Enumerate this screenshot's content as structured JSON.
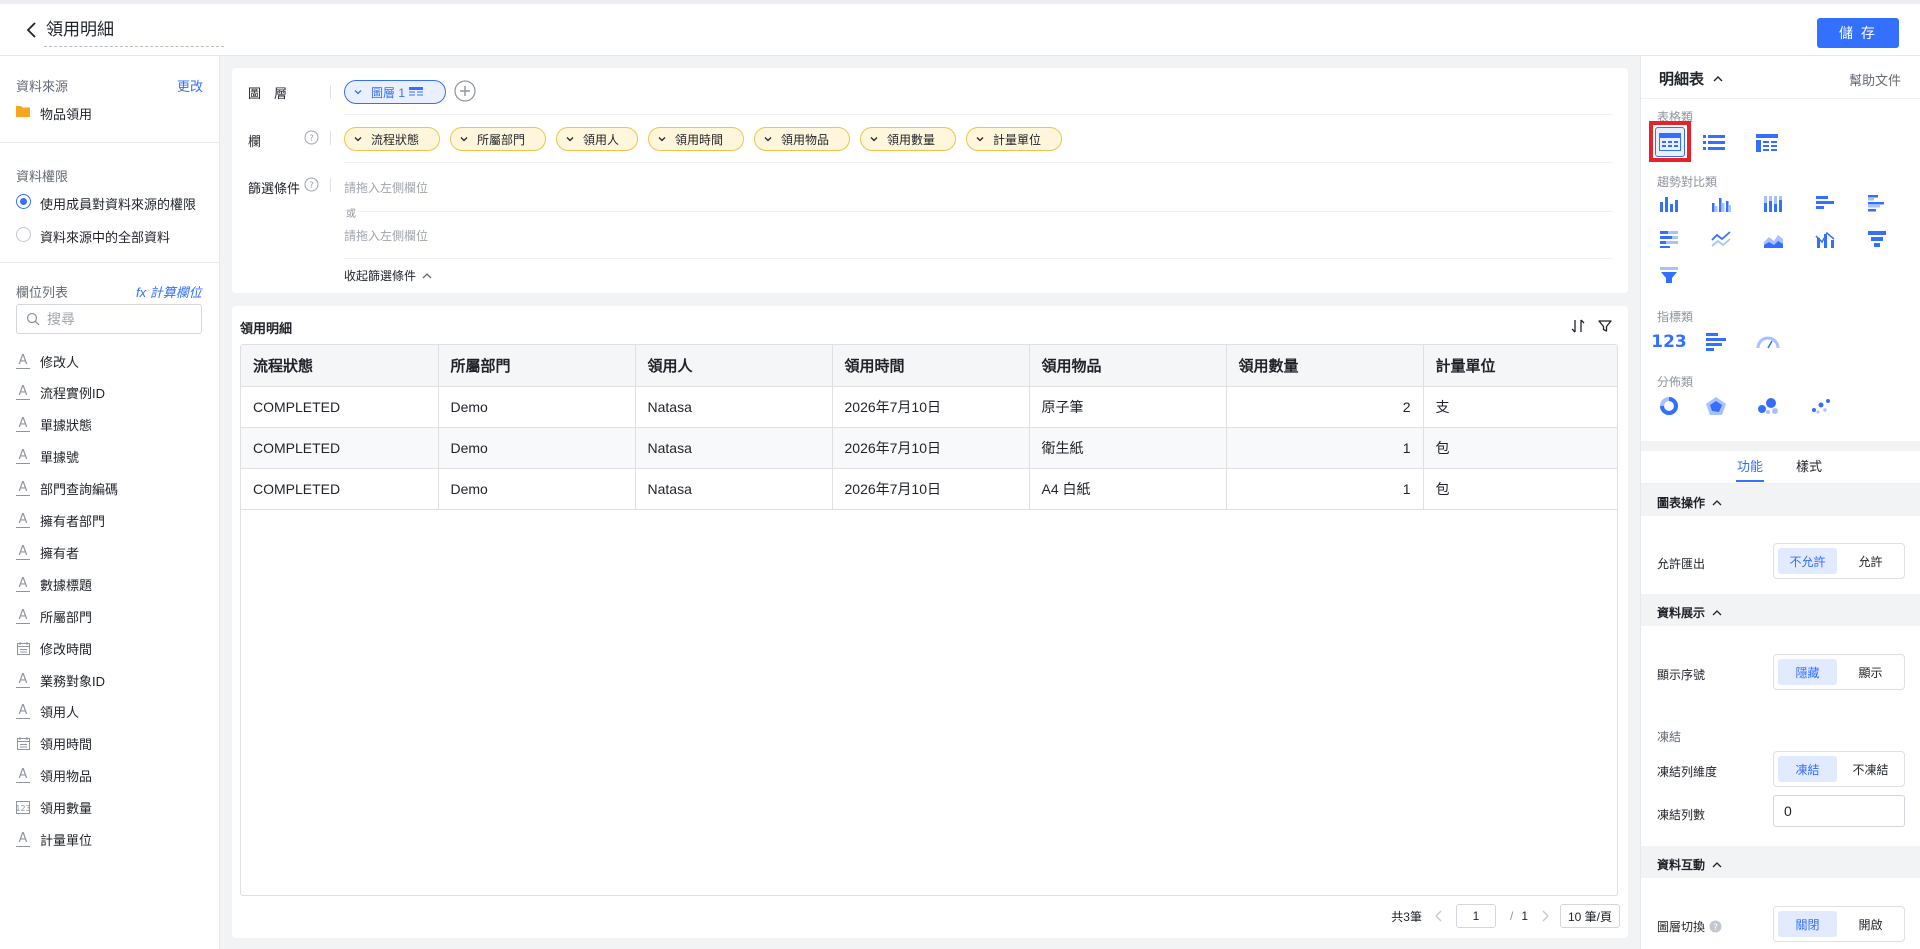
{
  "header": {
    "title": "領用明細",
    "save_label": "儲 存"
  },
  "left": {
    "datasource_label": "資料來源",
    "datasource_change": "更改",
    "datasource_name": "物品領用",
    "permission_label": "資料權限",
    "permission_options": [
      "使用成員對資料來源的權限",
      "資料來源中的全部資料"
    ],
    "permission_selected": 0,
    "fields_label": "欄位列表",
    "calc_field": "fx 計算欄位",
    "search_placeholder": "搜尋",
    "fields": [
      {
        "icon": "text",
        "label": "修改人"
      },
      {
        "icon": "text",
        "label": "流程實例ID"
      },
      {
        "icon": "text",
        "label": "單據狀態"
      },
      {
        "icon": "text",
        "label": "單據號"
      },
      {
        "icon": "text",
        "label": "部門查詢編碼"
      },
      {
        "icon": "text",
        "label": "擁有者部門"
      },
      {
        "icon": "text",
        "label": "擁有者"
      },
      {
        "icon": "text",
        "label": "數據標題"
      },
      {
        "icon": "text",
        "label": "所屬部門"
      },
      {
        "icon": "date",
        "label": "修改時間"
      },
      {
        "icon": "text",
        "label": "業務對象ID"
      },
      {
        "icon": "text",
        "label": "領用人"
      },
      {
        "icon": "date",
        "label": "領用時間"
      },
      {
        "icon": "text",
        "label": "領用物品"
      },
      {
        "icon": "number",
        "label": "領用數量"
      },
      {
        "icon": "text",
        "label": "計量單位"
      }
    ]
  },
  "config": {
    "layer_label": "圖　層",
    "layer_pill": "圖層 1",
    "column_label": "欄",
    "columns": [
      "流程狀態",
      "所屬部門",
      "領用人",
      "領用時間",
      "領用物品",
      "領用數量",
      "計量單位"
    ],
    "filter_label": "篩選條件",
    "filter_placeholder_1": "請拖入左側欄位",
    "filter_or": "或",
    "filter_placeholder_2": "請拖入左側欄位",
    "collapse_label": "收起篩選條件"
  },
  "table": {
    "title": "領用明細",
    "headers": [
      "流程狀態",
      "所屬部門",
      "領用人",
      "領用時間",
      "領用物品",
      "領用數量",
      "計量單位"
    ],
    "rows": [
      [
        "COMPLETED",
        "Demo",
        "Natasa",
        "2026年7月10日",
        "原子筆",
        "2",
        "支"
      ],
      [
        "COMPLETED",
        "Demo",
        "Natasa",
        "2026年7月10日",
        "衛生紙",
        "1",
        "包"
      ],
      [
        "COMPLETED",
        "Demo",
        "Natasa",
        "2026年7月10日",
        "A4 白紙",
        "1",
        "包"
      ]
    ],
    "pager": {
      "total": "共3筆",
      "page": "1",
      "sep": "/",
      "pages": "1",
      "page_size": "10 筆/頁"
    }
  },
  "right": {
    "title": "明細表",
    "help": "幫助文件",
    "cat_table": "表格類",
    "cat_trend": "趨勢對比類",
    "cat_indicator": "指標類",
    "cat_distribution": "分佈類",
    "tab_function": "功能",
    "tab_style": "樣式",
    "sec_chart_ops": "圖表操作",
    "allow_export_label": "允許匯出",
    "allow_export_options": [
      "不允許",
      "允許"
    ],
    "sec_display": "資料展示",
    "show_index_label": "顯示序號",
    "show_index_options": [
      "隱藏",
      "顯示"
    ],
    "freeze_label": "凍結",
    "freeze_col_label": "凍結列維度",
    "freeze_col_options": [
      "凍結",
      "不凍結"
    ],
    "freeze_count_label": "凍結列數",
    "freeze_count_value": "0",
    "sec_interact": "資料互動",
    "layer_switch_label": "圖層切換",
    "layer_switch_options": [
      "關閉",
      "開啟"
    ],
    "accent": "#3370ff",
    "highlight": "#e8212a"
  }
}
